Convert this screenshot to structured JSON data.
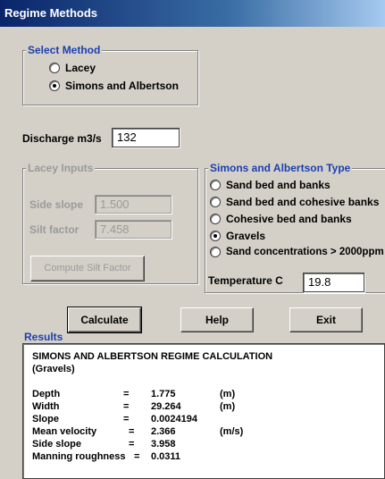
{
  "window": {
    "title": "Regime Methods"
  },
  "method_group": {
    "legend": "Select Method",
    "options": [
      {
        "label": "Lacey",
        "checked": false
      },
      {
        "label": "Simons and Albertson",
        "checked": true
      }
    ]
  },
  "discharge": {
    "label": "Discharge m3/s",
    "value": "132"
  },
  "lacey_inputs": {
    "legend": "Lacey Inputs",
    "side_slope_label": "Side slope",
    "side_slope_value": "1.500",
    "silt_factor_label": "Silt factor",
    "silt_factor_value": "7.458",
    "compute_button": "Compute Silt Factor"
  },
  "sa_type": {
    "legend": "Simons and Albertson Type",
    "options": [
      {
        "label": "Sand bed and banks",
        "checked": false
      },
      {
        "label": "Sand bed and cohesive banks",
        "checked": false
      },
      {
        "label": "Cohesive bed and banks",
        "checked": false
      },
      {
        "label": "Gravels",
        "checked": true
      },
      {
        "label": "Sand concentrations > 2000ppm",
        "checked": false
      }
    ],
    "temperature_label": "Temperature C",
    "temperature_value": "19.8"
  },
  "buttons": {
    "calculate": "Calculate",
    "help": "Help",
    "exit": "Exit"
  },
  "results": {
    "legend": "Results",
    "heading": "SIMONS AND ALBERTSON REGIME CALCULATION",
    "subheading": "(Gravels)",
    "rows": [
      {
        "name": "Depth",
        "eq": "=",
        "value": "1.775",
        "unit": "(m)"
      },
      {
        "name": "Width",
        "eq": "=",
        "value": "29.264",
        "unit": "(m)"
      },
      {
        "name": "Slope",
        "eq": "=",
        "value": "0.0024194",
        "unit": ""
      },
      {
        "name": "Mean velocity",
        "eq": "=",
        "value": "2.366",
        "unit": "(m/s)"
      },
      {
        "name": "Side slope",
        "eq": "=",
        "value": "3.958",
        "unit": ""
      },
      {
        "name": "Manning roughness",
        "eq": "=",
        "value": "0.0311",
        "unit": ""
      }
    ]
  }
}
